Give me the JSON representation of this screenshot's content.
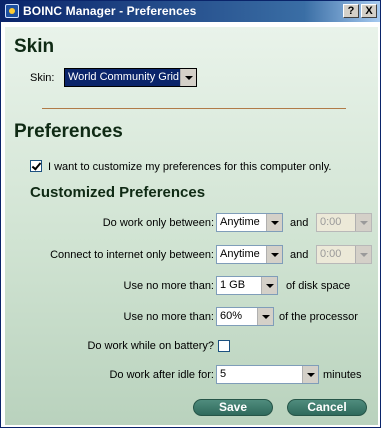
{
  "window": {
    "title": "BOINC Manager - Preferences",
    "help_label": "?",
    "close_label": "X"
  },
  "skin": {
    "heading": "Skin",
    "label": "Skin:",
    "selected": "World Community Grid"
  },
  "preferences": {
    "heading": "Preferences",
    "customize_checkbox": {
      "label": "I want to customize my preferences for this computer only.",
      "checked": true
    },
    "customized_heading": "Customized Preferences",
    "work_between": {
      "label": "Do work only between:",
      "start": "Anytime",
      "and_label": "and",
      "end": "0:00"
    },
    "connect_between": {
      "label": "Connect to internet only between:",
      "start": "Anytime",
      "and_label": "and",
      "end": "0:00"
    },
    "disk": {
      "label": "Use no more than:",
      "value": "1 GB",
      "suffix": "of disk space"
    },
    "processor": {
      "label": "Use no more than:",
      "value": "60%",
      "suffix": "of the processor"
    },
    "battery": {
      "label": "Do work while on battery?",
      "checked": false
    },
    "idle": {
      "label": "Do work after idle for:",
      "value": "5",
      "suffix": "minutes"
    }
  },
  "buttons": {
    "save": "Save",
    "cancel": "Cancel"
  },
  "colors": {
    "title_bar": "#0a246a",
    "panel_top": "#e9f3ea",
    "panel_bottom": "#b9d2bd",
    "button": "#2f6a5c",
    "divider": "#b07b48"
  }
}
